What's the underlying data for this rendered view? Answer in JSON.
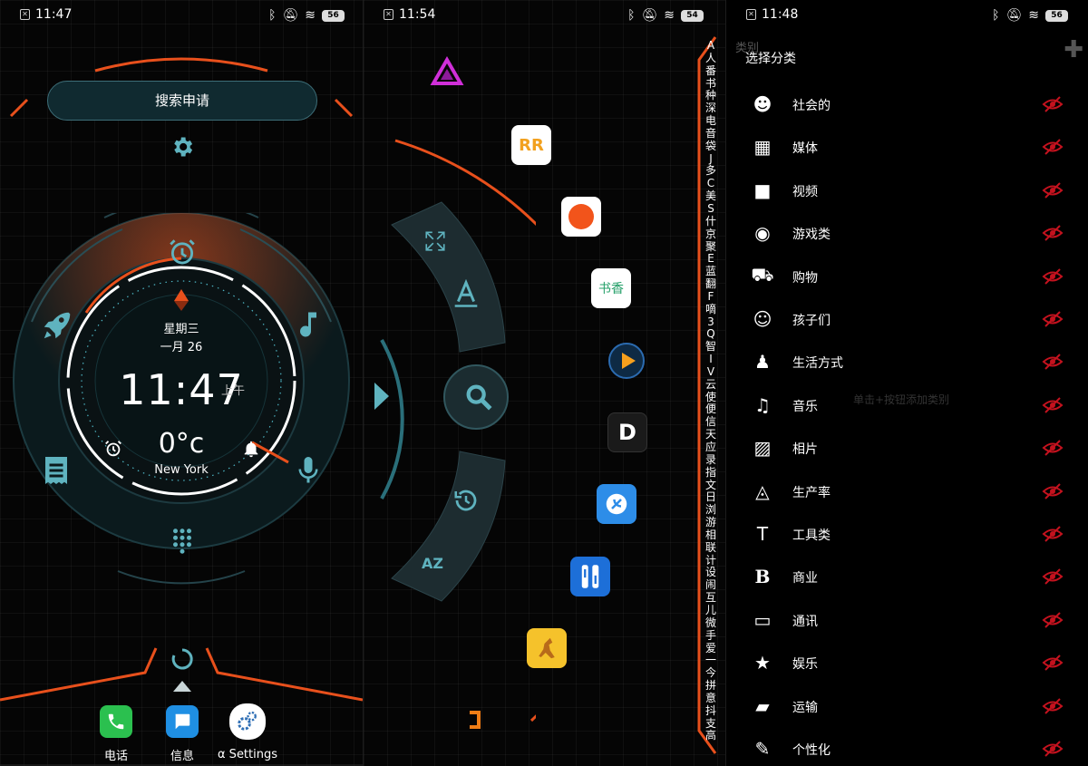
{
  "colors": {
    "accent_orange": "#e8501c",
    "accent_teal": "#4fb7c6",
    "dark_teal": "#143439",
    "hidden_red": "#c4121e"
  },
  "panel1": {
    "status": {
      "time": "11:47",
      "battery": "56"
    },
    "search_button": "搜索申请",
    "clock": {
      "weekday": "星期三",
      "date": "一月 26",
      "time": "11:47",
      "ampm": "上午",
      "temperature": "0°c",
      "city": "New York"
    },
    "ring_icons": [
      "alarm-clock-icon",
      "rocket-icon",
      "music-note-icon",
      "notes-icon",
      "microphone-icon",
      "dialpad-icon",
      "alarm-icon",
      "bell-icon"
    ],
    "dock": [
      {
        "label": "电话",
        "icon": "phone-icon",
        "color": "#2bc04f"
      },
      {
        "label": "信息",
        "icon": "message-icon",
        "color": "#1f8fe3"
      },
      {
        "label": "α Settings",
        "icon": "settings-gears-icon",
        "color": "#ffffff"
      }
    ]
  },
  "panel2": {
    "status": {
      "time": "11:54",
      "battery": "54"
    },
    "apps": [
      {
        "icon": "launcher-logo-icon",
        "caption": ""
      },
      {
        "icon": "rr-app-icon",
        "caption": ""
      },
      {
        "icon": "orange-app-icon",
        "caption": ""
      },
      {
        "icon": "book-app-icon",
        "caption": "书香"
      },
      {
        "icon": "video-play-icon",
        "caption": ""
      },
      {
        "icon": "d-app-icon",
        "caption": ""
      },
      {
        "icon": "satellite-app-icon",
        "caption": ""
      },
      {
        "icon": "tuner-app-icon",
        "caption": ""
      },
      {
        "icon": "kangaroo-app-icon",
        "caption": ""
      },
      {
        "icon": "office-app-icon",
        "caption": ""
      }
    ],
    "alphabet": [
      "A",
      "人",
      "番",
      "书",
      "种",
      "深",
      "电",
      "音",
      "袋",
      "J",
      "多",
      "C",
      "美",
      "S",
      "什",
      "京",
      "聚",
      "E",
      "蓝",
      "翻",
      "F",
      "嘀",
      "3",
      "Q",
      "智",
      "I",
      "V",
      "云",
      "使",
      "便",
      "信",
      "天",
      "应",
      "录",
      "指",
      "文",
      "日",
      "浏",
      "游",
      "相",
      "联",
      "计",
      "设",
      "闹",
      "互",
      "儿",
      "微",
      "手",
      "爱",
      "一",
      "今",
      "拼",
      "意",
      "抖",
      "支",
      "高"
    ]
  },
  "panel3": {
    "status": {
      "time": "11:48",
      "battery": "56"
    },
    "bg_title": "类别",
    "title": "选择分类",
    "hint": "单击+按钮添加类别",
    "categories": [
      {
        "label": "社会的",
        "icon": "person-icon"
      },
      {
        "label": "媒体",
        "icon": "film-icon"
      },
      {
        "label": "视频",
        "icon": "video-camera-icon"
      },
      {
        "label": "游戏类",
        "icon": "gamepad-icon"
      },
      {
        "label": "购物",
        "icon": "cart-icon"
      },
      {
        "label": "孩子们",
        "icon": "smiley-icon"
      },
      {
        "label": "生活方式",
        "icon": "spy-icon"
      },
      {
        "label": "音乐",
        "icon": "music-icon"
      },
      {
        "label": "相片",
        "icon": "photo-icon"
      },
      {
        "label": "生产率",
        "icon": "chart-icon"
      },
      {
        "label": "工具类",
        "icon": "hammer-icon"
      },
      {
        "label": "商业",
        "icon": "bold-b-icon"
      },
      {
        "label": "通讯",
        "icon": "chat-icon"
      },
      {
        "label": "娱乐",
        "icon": "star-icon"
      },
      {
        "label": "运输",
        "icon": "car-icon"
      },
      {
        "label": "个性化",
        "icon": "brush-icon"
      }
    ]
  }
}
